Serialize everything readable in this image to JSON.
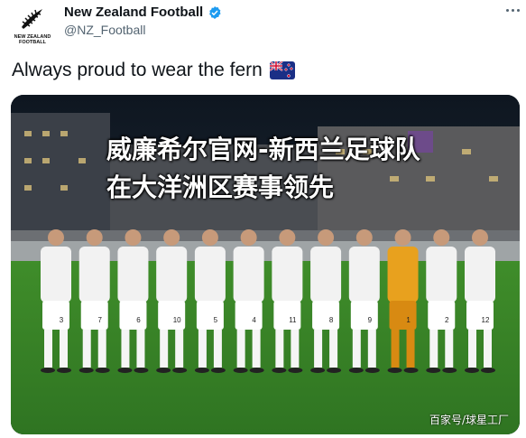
{
  "account": {
    "display_name": "New Zealand Football",
    "handle": "@NZ_Football",
    "logo_text_line1": "NEW ZEALAND",
    "logo_text_line2": "FOOTBALL"
  },
  "tweet": {
    "text": "Always proud to wear the fern",
    "emoji": "flag-new-zealand"
  },
  "media": {
    "overlay_title": "威廉希尔官网-新西兰足球队在大洋洲区赛事领先",
    "watermark": "百家号/球星工厂",
    "jersey_numbers": [
      "3",
      "7",
      "6",
      "10",
      "5",
      "4",
      "11",
      "8",
      "9",
      "1",
      "2",
      "12"
    ]
  },
  "colors": {
    "verified_blue": "#1d9bf0",
    "text_primary": "#0f1419",
    "text_secondary": "#536471"
  },
  "icons": {
    "more": "more-icon",
    "verified": "verified-icon",
    "avatar": "fern-logo"
  }
}
